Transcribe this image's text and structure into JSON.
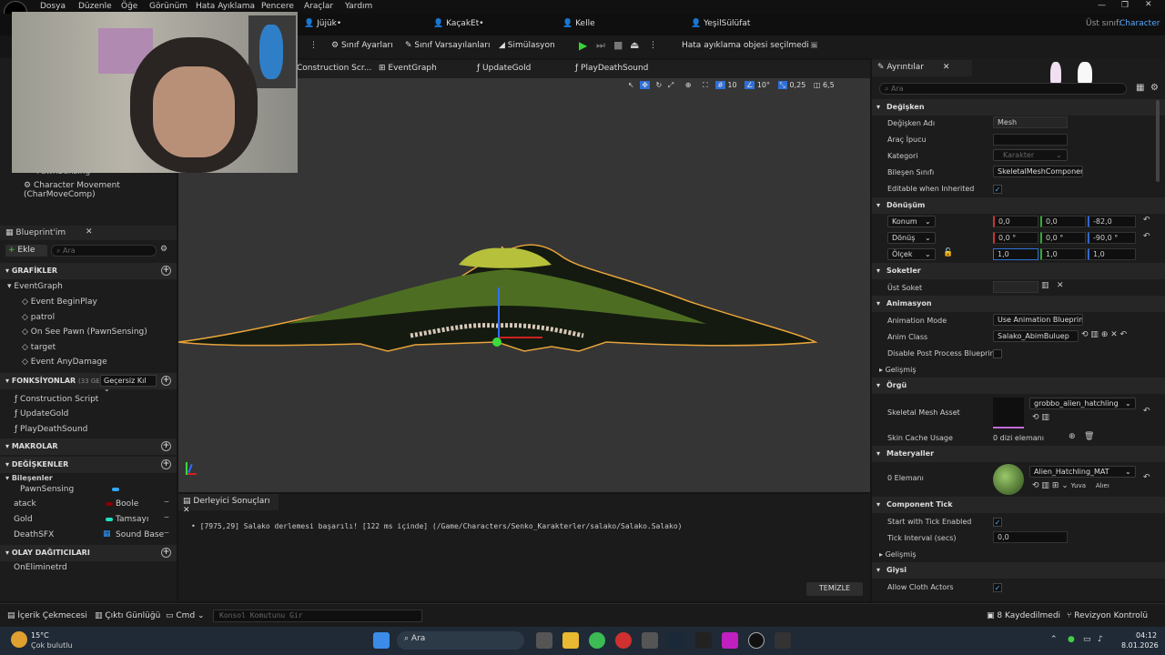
{
  "menu": [
    "Dosya",
    "Düzenle",
    "Öğe",
    "Görünüm",
    "Hata Ayıklama",
    "Pencere",
    "Araçlar",
    "Yardım"
  ],
  "doc_tabs": [
    "Jüjük•",
    "KaçakEt•",
    "Kelle",
    "YeşilSülüfat"
  ],
  "parent_class": {
    "label": "Üst sınıf:",
    "value": "Character"
  },
  "toolbar": {
    "class_settings": "Sınıf Ayarları",
    "class_defaults": "Sınıf Varsayılanları",
    "simulation": "Simülasyon",
    "debug_object": "Hata ayıklama objesi seçilmedi"
  },
  "graph_tabs": [
    "Construction Scr...",
    "EventGraph",
    "UpdateGold",
    "PlayDeathSound"
  ],
  "viewport": {
    "grid_snap": "10",
    "rot_snap": "10°",
    "scale_snap": "0,25",
    "cam_speed": "6,5"
  },
  "components": {
    "partial_label": "PawnSensing",
    "movement": "Character Movement (CharMoveComp)"
  },
  "blueprint_panel": {
    "title": "Blueprint'im",
    "add_label": "Ekle",
    "search_placeholder": "Ara",
    "graphs_header": "GRAFİKLER",
    "graphs": [
      "EventGraph",
      "Event BeginPlay",
      "patrol",
      "On See Pawn (PawnSensing)",
      "target",
      "Event AnyDamage"
    ],
    "functions_header": "FONKSİYONLAR",
    "functions_count": "(33 GEÇERSİZ",
    "override_label": "Geçersiz Kıl",
    "functions": [
      "Construction Script",
      "UpdateGold",
      "PlayDeathSound"
    ],
    "macros_header": "MAKROLAR",
    "variables_header": "DEĞİŞKENLER",
    "components_label": "Bileşenler",
    "variables": [
      {
        "name": "PawnSensing",
        "type": "",
        "color": "#2fa8ff"
      },
      {
        "name": "atack",
        "type": "Boole",
        "color": "#8b0000"
      },
      {
        "name": "Gold",
        "type": "Tamsayı",
        "color": "#1fe0c0"
      },
      {
        "name": "DeathSFX",
        "type": "Sound Base",
        "color": "#2a9aff"
      }
    ],
    "dispatchers_header": "OLAY DAĞITICILARI",
    "dispatchers": [
      "OnEliminetrd"
    ]
  },
  "compiler": {
    "tab": "Derleyici Sonuçları",
    "message": "[7975,29] Salako derlemesi başarılı! [122 ms içinde] (/Game/Characters/Senko_Karakterler/salako/Salako.Salako)",
    "clear_label": "TEMİZLE"
  },
  "details": {
    "tab": "Ayrıntılar",
    "search_placeholder": "Ara",
    "variable_section": "Değişken",
    "var_name_label": "Değişken Adı",
    "var_name": "Mesh",
    "tooltip_label": "Araç İpucu",
    "tooltip": "",
    "category_label": "Kategori",
    "category": "Karakter",
    "component_class_label": "Bileşen Sınıfı",
    "component_class": "SkeletalMeshComponent",
    "editable_inherited_label": "Editable when Inherited",
    "transform_section": "Dönüşüm",
    "location_label": "Konum",
    "location": [
      "0,0",
      "0,0",
      "-82,0"
    ],
    "rotation_label": "Dönüş",
    "rotation": [
      "0,0 °",
      "0,0 °",
      "-90,0 °"
    ],
    "scale_label": "Ölçek",
    "scale": [
      "1,0",
      "1,0",
      "1,0"
    ],
    "sockets_section": "Soketler",
    "parent_socket_label": "Üst Soket",
    "parent_socket": "",
    "animation_section": "Animasyon",
    "anim_mode_label": "Animation Mode",
    "anim_mode": "Use Animation Blueprint",
    "anim_class_label": "Anim Class",
    "anim_class": "Salako_AbimBuluep",
    "disable_pp_label": "Disable Post Process Blueprint",
    "advanced": "Gelişmiş",
    "mesh_section": "Örgü",
    "skeletal_mesh_label": "Skeletal Mesh Asset",
    "skeletal_mesh": "grobbo_alien_hatchling",
    "skin_cache_label": "Skin Cache Usage",
    "skin_cache": "0 dizi elemanı",
    "materials_section": "Materyaller",
    "elements_label": "0 Elemanı",
    "material": "Alien_Hatchling_MAT",
    "mat_home": "Yuva",
    "mat_all": "Alıeı",
    "tick_section": "Component Tick",
    "start_tick_label": "Start with Tick Enabled",
    "tick_interval_label": "Tick Interval (secs)",
    "tick_interval": "0,0",
    "advanced2": "Gelişmiş",
    "cloth_section": "Giysi",
    "allow_cloth_label": "Allow Cloth Actors"
  },
  "statusbar": {
    "content_drawer": "İçerik Çekmecesi",
    "output_log": "Çıktı Günlüğü",
    "cmd": "Cmd",
    "console_placeholder": "Konsol Komutunu Gir",
    "saved": "8 Kaydedilmedi",
    "revision": "Revizyon Kontrolü"
  },
  "taskbar": {
    "temp": "15°C",
    "weather": "Çok bulutlu",
    "search": "Ara",
    "time": "04:12",
    "date": "8.01.2026"
  }
}
